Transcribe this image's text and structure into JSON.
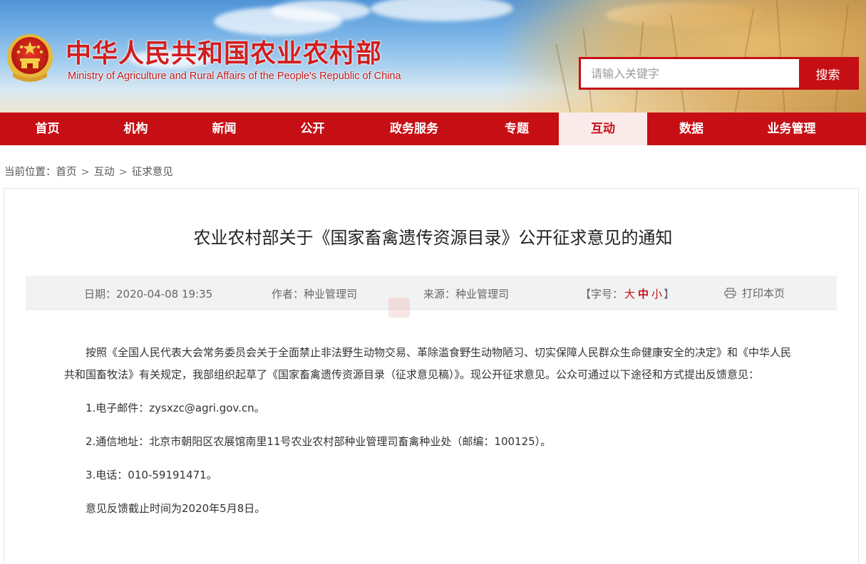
{
  "header": {
    "title_cn": "中华人民共和国农业农村部",
    "title_en": "Ministry of Agriculture and Rural Affairs of the People's Republic of China",
    "search": {
      "placeholder": "请输入关键字",
      "value": "",
      "button_label": "搜索"
    },
    "colors": {
      "brand_red": "#c50f15",
      "logo_red": "#d21e1e"
    }
  },
  "nav": {
    "items": [
      {
        "label": "首页"
      },
      {
        "label": "机构"
      },
      {
        "label": "新闻"
      },
      {
        "label": "公开"
      },
      {
        "label": "政务服务"
      },
      {
        "label": "专题"
      },
      {
        "label": "互动",
        "active": true
      },
      {
        "label": "数据"
      },
      {
        "label": "业务管理"
      }
    ]
  },
  "breadcrumb": {
    "prefix": "当前位置：",
    "items": [
      "首页",
      "互动",
      "征求意见"
    ],
    "separator": ">"
  },
  "article": {
    "title": "农业农村部关于《国家畜禽遗传资源目录》公开征求意见的通知",
    "meta": {
      "date": "日期：2020-04-08 19:35",
      "author": "作者：种业管理司",
      "source": "来源：种业管理司",
      "font_size_prefix": "【字号：",
      "font_sizes": [
        "大",
        "中",
        "小"
      ],
      "font_size_suffix": "】",
      "print_label": "打印本页"
    },
    "body": {
      "paragraph_1": "按照《全国人民代表大会常务委员会关于全面禁止非法野生动物交易、革除滥食野生动物陋习、切实保障人民群众生命健康安全的决定》和《中华人民共和国畜牧法》有关规定，我部组织起草了《国家畜禽遗传资源目录（征求意见稿）》。现公开征求意见。公众可通过以下途径和方式提出反馈意见：",
      "item_1": "1.电子邮件：zysxzc@agri.gov.cn。",
      "item_2": "2.通信地址：北京市朝阳区农展馆南里11号农业农村部种业管理司畜禽种业处（邮编：100125）。",
      "item_3": "3.电话：010-59191471。",
      "deadline": "意见反馈截止时间为2020年5月8日。"
    }
  },
  "icons": [
    "national-emblem-icon",
    "printer-icon"
  ]
}
